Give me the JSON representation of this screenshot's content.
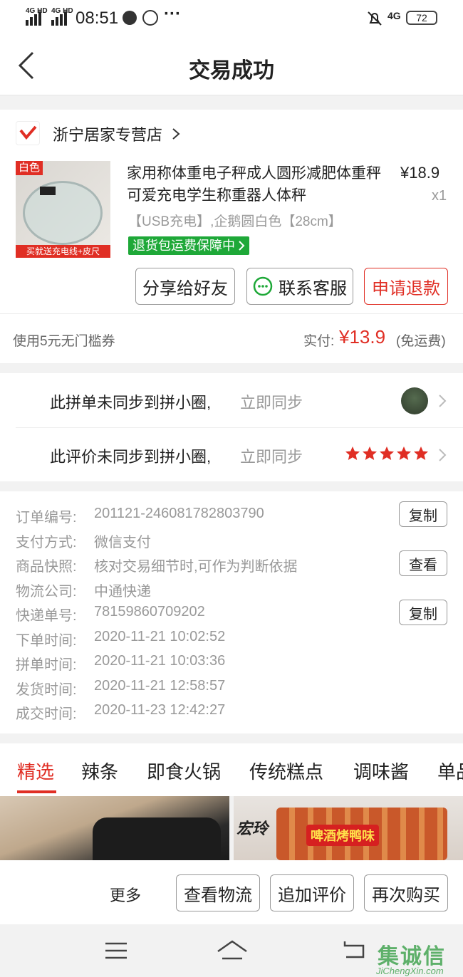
{
  "status_bar": {
    "net1": "4G HD",
    "net2": "4G HD",
    "time": "08:51",
    "dots": "···",
    "net3": "4G",
    "battery": "72"
  },
  "header": {
    "title": "交易成功"
  },
  "shop": {
    "name": "浙宁居家专营店"
  },
  "product": {
    "badge": "白色",
    "promo": "买就送充电线+皮尺",
    "title": "家用称体重电子秤成人圆形减肥体重秤可爱充电学生称重器人体秤",
    "price": "¥18.9",
    "qty": "x1",
    "spec": "【USB充电】,企鹅圆白色【28cm】",
    "guarantee": "退货包运费保障中"
  },
  "buttons": {
    "share": "分享给好友",
    "service": "联系客服",
    "refund": "申请退款"
  },
  "payment": {
    "coupon": "使用5元无门槛券",
    "paid_label": "实付:",
    "paid_value": "¥13.9",
    "shipping": "(免运费)"
  },
  "sync": {
    "row1_text": "此拼单未同步到拼小圈,",
    "row1_action": "立即同步",
    "row2_text": "此评价未同步到拼小圈,",
    "row2_action": "立即同步",
    "rating": 5
  },
  "details": [
    {
      "label": "订单编号:",
      "value": "201121-246081782803790",
      "button": "复制"
    },
    {
      "label": "支付方式:",
      "value": "微信支付"
    },
    {
      "label": "商品快照:",
      "value": "核对交易细节时,可作为判断依据",
      "button": "查看"
    },
    {
      "label": "物流公司:",
      "value": "中通快递"
    },
    {
      "label": "快递单号:",
      "value": "78159860709202",
      "button": "复制"
    },
    {
      "label": "下单时间:",
      "value": "2020-11-21 10:02:52"
    },
    {
      "label": "拼单时间:",
      "value": "2020-11-21 10:03:36"
    },
    {
      "label": "发货时间:",
      "value": "2020-11-21 12:58:57"
    },
    {
      "label": "成交时间:",
      "value": "2020-11-23 12:42:27"
    }
  ],
  "tabs": [
    "精选",
    "辣条",
    "即食火锅",
    "传统糕点",
    "调味酱",
    "单品"
  ],
  "recommend": {
    "brand_text": "宏玲",
    "product_text": "啤酒烤鸭味"
  },
  "actions": {
    "more": "更多",
    "logistics": "查看物流",
    "review": "追加评价",
    "rebuy": "再次购买"
  },
  "watermark": {
    "cn": "集诚信",
    "en": "JiChengXin.com"
  },
  "colors": {
    "accent": "#e02e24",
    "green": "#1ea838",
    "gray_text": "#999999"
  }
}
